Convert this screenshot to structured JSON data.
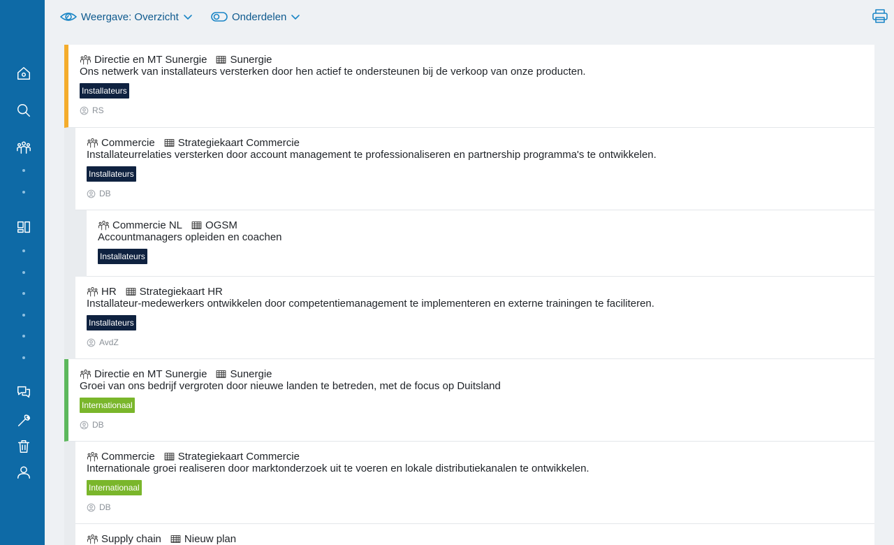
{
  "toolbar": {
    "view_label": "Weergave: Overzicht",
    "parts_label": "Onderdelen"
  },
  "cards": [
    {
      "team": "Directie en MT Sunergie",
      "plan": "Sunergie",
      "text": "Ons netwerk van installateurs versterken door hen actief te ondersteunen bij de verkoop van onze producten.",
      "tag": "Installateurs",
      "owner": "RS"
    },
    {
      "team": "Commercie",
      "plan": "Strategiekaart Commercie",
      "text": "Installateurrelaties versterken door account management te professionaliseren en partnership programma's te ontwikkelen.",
      "tag": "Installateurs",
      "owner": "DB"
    },
    {
      "team": "Commercie NL",
      "plan": "OGSM",
      "text": "Accountmanagers opleiden en coachen",
      "tag": "Installateurs",
      "owner": ""
    },
    {
      "team": "HR",
      "plan": "Strategiekaart HR",
      "text": "Installateur-medewerkers ontwikkelen door competentiemanagement te implementeren en externe trainingen te faciliteren.",
      "tag": "Installateurs",
      "owner": "AvdZ"
    },
    {
      "team": "Directie en MT Sunergie",
      "plan": "Sunergie",
      "text": "Groei van ons bedrijf vergroten door nieuwe landen te betreden, met de focus op Duitsland",
      "tag": "Internationaal",
      "owner": "DB"
    },
    {
      "team": "Commercie",
      "plan": "Strategiekaart Commercie",
      "text": "Internationale groei realiseren door marktonderzoek uit te voeren en lokale distributiekanalen te ontwikkelen.",
      "tag": "Internationaal",
      "owner": "DB"
    },
    {
      "team": "Supply chain",
      "plan": "Nieuw plan",
      "text": "",
      "tag": "",
      "owner": ""
    }
  ],
  "colors": {
    "sidebar": "#0e6aa6",
    "accent_orange": "#f4ac2c",
    "accent_green": "#5cb85c",
    "badge_navy": "#0f2240",
    "badge_green": "#7ab62b"
  },
  "icons": {
    "sidebar": [
      "home-icon",
      "search-icon",
      "team-icon",
      "dashboard-icon",
      "chat-icon",
      "wrench-icon",
      "trash-icon",
      "user-icon"
    ],
    "toolbar": [
      "eye-icon",
      "toggle-icon",
      "print-icon"
    ],
    "card": [
      "team-icon",
      "table-icon",
      "user-circle-icon"
    ]
  }
}
